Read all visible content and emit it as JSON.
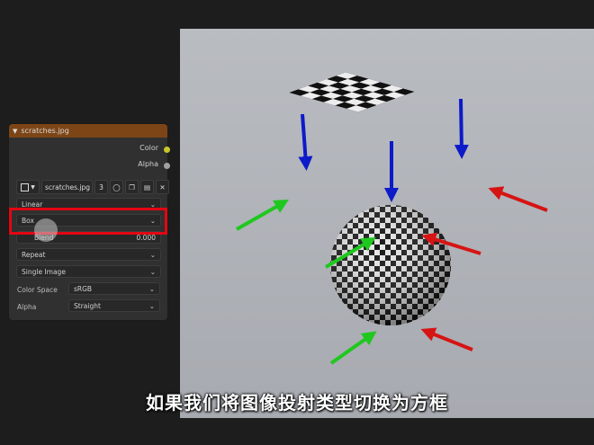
{
  "node": {
    "title": "scratches.jpg",
    "outputs": [
      "Color",
      "Alpha"
    ],
    "image_name": "scratches.jpg",
    "user_count": "3",
    "interpolation": "Linear",
    "projection": "Box",
    "blend_label": "Blend",
    "blend_value": "0.000",
    "extension": "Repeat",
    "source": "Single Image",
    "color_space_label": "Color Space",
    "color_space": "sRGB",
    "alpha_label": "Alpha",
    "alpha": "Straight"
  },
  "colors": {
    "header": "#7d4516",
    "highlight": "#e30613",
    "color_socket": "#c7c729",
    "alpha_socket": "#a1a1a1",
    "arrow_blue": "#0d1ac9",
    "arrow_green": "#1ec81e",
    "arrow_red": "#d61414"
  },
  "icons": [
    "image-type-icon",
    "chevron-down-icon",
    "fake-user-shield-icon",
    "duplicate-icon",
    "open-folder-icon",
    "close-icon"
  ],
  "subtitle": "如果我们将图像投射类型切换为方框"
}
